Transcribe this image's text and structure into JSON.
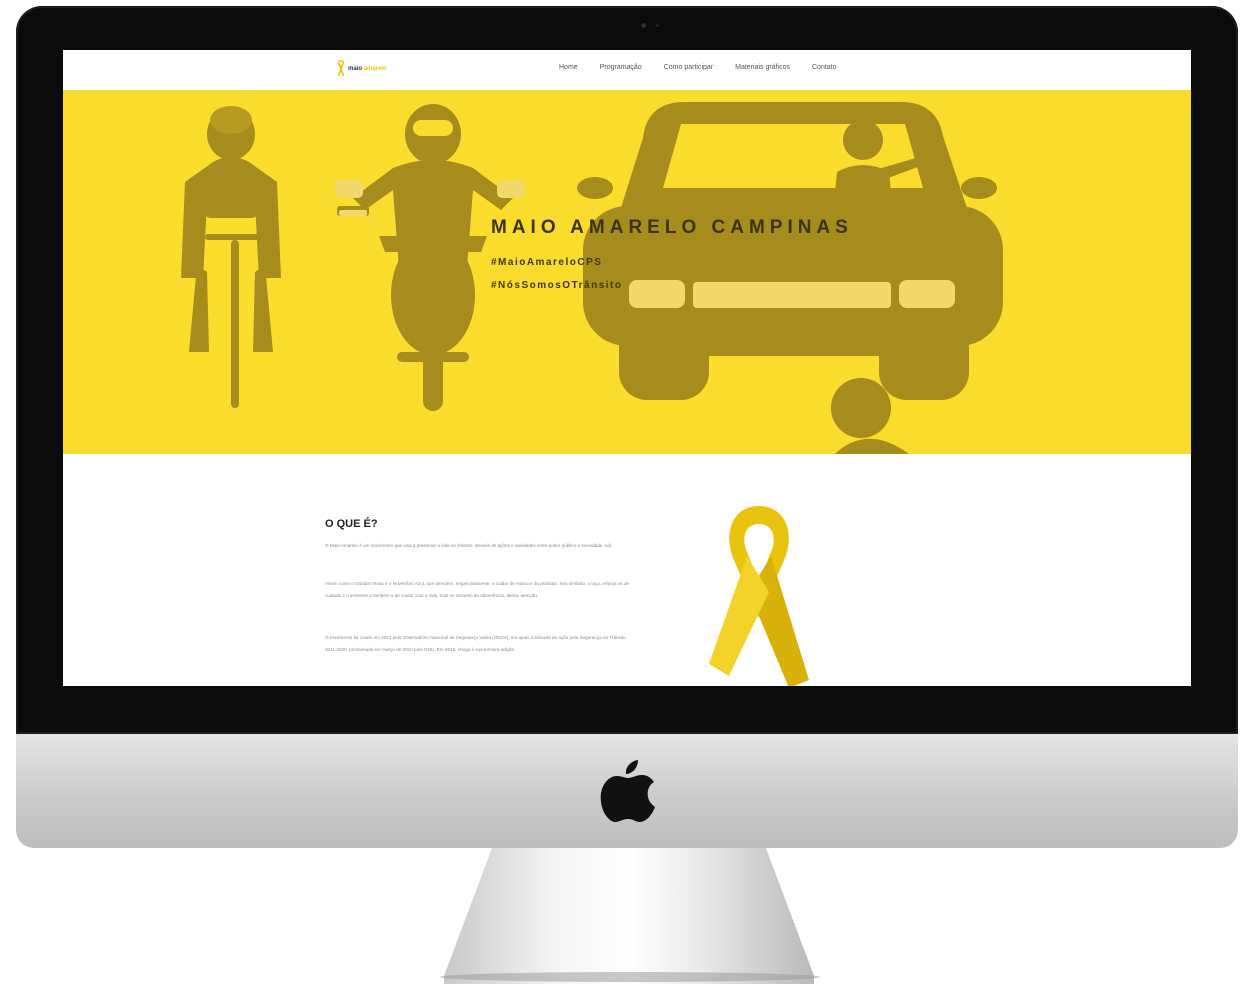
{
  "site": {
    "logo_text_a": "maio",
    "logo_text_b": "amarelo",
    "nav": [
      "Home",
      "Programação",
      "Como participar",
      "Materiais gráficos",
      "Contato"
    ]
  },
  "hero": {
    "title": "MAIO AMARELO CAMPINAS",
    "hashtags": [
      "#MaioAmareloCPS",
      "#NósSomosOTrânsito"
    ]
  },
  "about": {
    "heading": "O QUE É?",
    "paragraphs": [
      "O Maio Amarelo é um movimento que visa a preservar a vida no trânsito, através de ações e atividades entre poder público e sociedade civil.",
      "Assim como o Outubro Rosa e o Novembro Azul, que atendem, respectivamente, a cuidar de mama e da próstata. Seu símbolo, o laço, reforça os de cuidado e o lembrete à também a de cuidar com a vida, mas no amarelo da advertência, alerta, atenção.",
      "O movimento foi criado em 2014 pelo Observatório Nacional de Segurança Viária (ONSV), em apoio à Década de ação pela Segurança no Trânsito 2011-2020, proclamada em março de 2010 pela ONU. Em 2016, chega à sua terceira edição."
    ]
  },
  "colors": {
    "hero_yellow": "#f9dc2c",
    "silhouette": "#a68b1d",
    "ribbon": "#e9c40f"
  }
}
